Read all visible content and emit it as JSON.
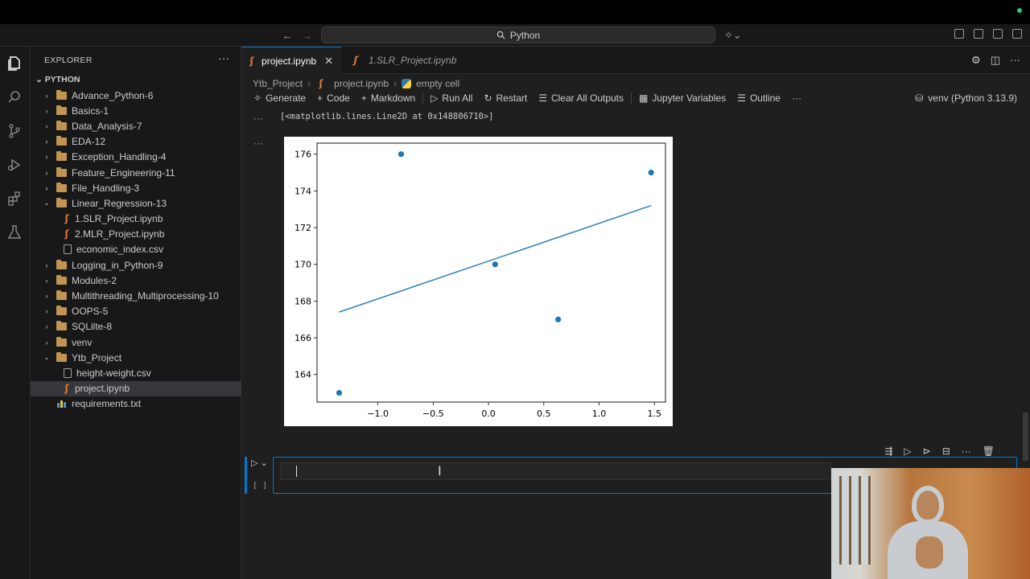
{
  "window": {
    "command_center": "Python"
  },
  "sidebar": {
    "title": "EXPLORER",
    "root": "PYTHON",
    "items": [
      {
        "label": "Advance_Python-6",
        "kind": "folder",
        "level": 1,
        "expanded": false
      },
      {
        "label": "Basics-1",
        "kind": "folder",
        "level": 1,
        "expanded": false
      },
      {
        "label": "Data_Analysis-7",
        "kind": "folder",
        "level": 1,
        "expanded": false
      },
      {
        "label": "EDA-12",
        "kind": "folder",
        "level": 1,
        "expanded": false
      },
      {
        "label": "Exception_Handling-4",
        "kind": "folder",
        "level": 1,
        "expanded": false
      },
      {
        "label": "Feature_Engineering-11",
        "kind": "folder",
        "level": 1,
        "expanded": false
      },
      {
        "label": "File_Handling-3",
        "kind": "folder",
        "level": 1,
        "expanded": false
      },
      {
        "label": "Linear_Regression-13",
        "kind": "folder",
        "level": 1,
        "expanded": true
      },
      {
        "label": "1.SLR_Project.ipynb",
        "kind": "notebook",
        "level": 2
      },
      {
        "label": "2.MLR_Project.ipynb",
        "kind": "notebook",
        "level": 2
      },
      {
        "label": "economic_index.csv",
        "kind": "csv",
        "level": 2
      },
      {
        "label": "Logging_in_Python-9",
        "kind": "folder",
        "level": 1,
        "expanded": false
      },
      {
        "label": "Modules-2",
        "kind": "folder",
        "level": 1,
        "expanded": false
      },
      {
        "label": "Multithreading_Multiprocessing-10",
        "kind": "folder",
        "level": 1,
        "expanded": false
      },
      {
        "label": "OOPS-5",
        "kind": "folder",
        "level": 1,
        "expanded": false
      },
      {
        "label": "SQLilte-8",
        "kind": "folder",
        "level": 1,
        "expanded": false
      },
      {
        "label": "venv",
        "kind": "folder",
        "level": 1,
        "expanded": false
      },
      {
        "label": "Ytb_Project",
        "kind": "folder",
        "level": 1,
        "expanded": true
      },
      {
        "label": "height-weight.csv",
        "kind": "csv",
        "level": 2
      },
      {
        "label": "project.ipynb",
        "kind": "notebook",
        "level": 2,
        "selected": true
      },
      {
        "label": "requirements.txt",
        "kind": "txt",
        "level": 1
      }
    ]
  },
  "tabs": [
    {
      "label": "project.ipynb",
      "active": true
    },
    {
      "label": "1.SLR_Project.ipynb",
      "active": false
    }
  ],
  "breadcrumb": {
    "folder": "Ytb_Project",
    "file": "project.ipynb",
    "cell": "empty cell"
  },
  "toolbar": {
    "generate": "Generate",
    "code": "Code",
    "markdown": "Markdown",
    "run_all": "Run All",
    "restart": "Restart",
    "clear_outputs": "Clear All Outputs",
    "variables": "Jupyter Variables",
    "outline": "Outline",
    "more": "···",
    "kernel": "venv (Python 3.13.9)"
  },
  "output": {
    "text": "[<matplotlib.lines.Line2D at 0x148806710>]",
    "dots": "···"
  },
  "cell": {
    "exec_count": "[ ]"
  },
  "chart_data": {
    "type": "scatter",
    "title": "",
    "xlabel": "",
    "ylabel": "",
    "xlim": [
      -1.55,
      1.6
    ],
    "ylim": [
      162.5,
      176.6
    ],
    "xticks": [
      -1.0,
      -0.5,
      0.0,
      0.5,
      1.0,
      1.5
    ],
    "xtick_labels": [
      "−1.0",
      "−0.5",
      "0.0",
      "0.5",
      "1.0",
      "1.5"
    ],
    "yticks": [
      164,
      166,
      168,
      170,
      172,
      174,
      176
    ],
    "ytick_labels": [
      "164",
      "166",
      "168",
      "170",
      "172",
      "174",
      "176"
    ],
    "points": [
      {
        "x": -1.35,
        "y": 163
      },
      {
        "x": -0.79,
        "y": 176
      },
      {
        "x": 0.06,
        "y": 170
      },
      {
        "x": 0.63,
        "y": 167
      },
      {
        "x": 1.47,
        "y": 175
      }
    ],
    "line": [
      {
        "x": -1.35,
        "y": 167.4
      },
      {
        "x": 1.47,
        "y": 173.2
      }
    ],
    "color": "#1f77b4",
    "grid": false
  }
}
